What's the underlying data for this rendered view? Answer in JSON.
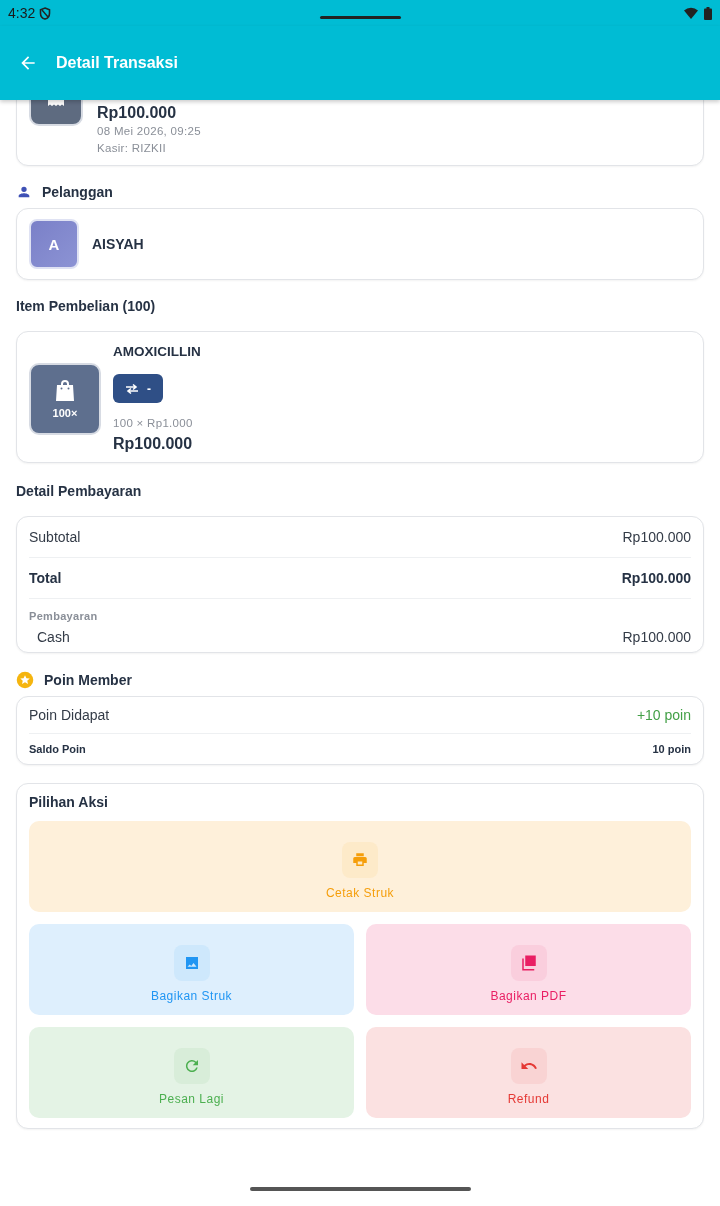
{
  "status_bar": {
    "time": "4:32"
  },
  "app_bar": {
    "title": "Detail Transaksi"
  },
  "summary": {
    "amount": "Rp100.000",
    "date": "08 Mei 2026, 09:25",
    "cashier": "Kasir: RIZKII"
  },
  "customer": {
    "heading": "Pelanggan",
    "initial": "A",
    "name": "AISYAH"
  },
  "items": {
    "heading": "Item Pembelian (100)",
    "list": [
      {
        "qty_badge": "100×",
        "name": "AMOXICILLIN",
        "unit_label": "-",
        "price_line": "100 × Rp1.000",
        "total": "Rp100.000"
      }
    ]
  },
  "payment": {
    "heading": "Detail Pembayaran",
    "rows": [
      {
        "kind": "normal",
        "label": "Subtotal",
        "value": "Rp100.000"
      },
      {
        "kind": "total",
        "label": "Total",
        "value": "Rp100.000"
      }
    ],
    "methods_label": "Pembayaran",
    "methods": [
      {
        "label": "Cash",
        "value": "Rp100.000"
      }
    ]
  },
  "points": {
    "heading": "Poin Member",
    "earned_label": "Poin Didapat",
    "earned_value": "+10 poin",
    "balance_label": "Saldo Poin",
    "balance_value": "10 poin"
  },
  "actions": {
    "heading": "Pilihan Aksi",
    "buttons": [
      {
        "kind": "print",
        "label": "Cetak Struk",
        "color": "#f59e0b"
      },
      {
        "kind": "image",
        "label": "Bagikan Struk",
        "color": "#2196f3"
      },
      {
        "kind": "pdf",
        "label": "Bagikan PDF",
        "color": "#e91e63"
      },
      {
        "kind": "reorder",
        "label": "Pesan Lagi",
        "color": "#4caf50"
      },
      {
        "kind": "refund",
        "label": "Refund",
        "color": "#e53935"
      }
    ]
  }
}
